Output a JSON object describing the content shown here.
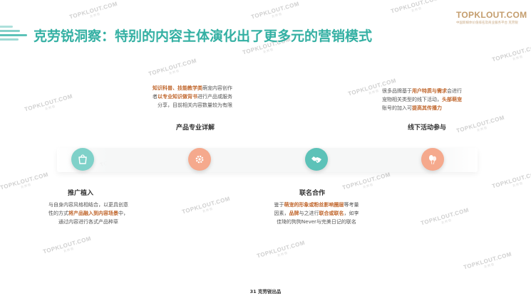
{
  "title": "克劳锐洞察：特别的内容主体演化出了更多元的营销模式",
  "logo": {
    "name": "TOPKLOUT.COM",
    "tagline": "中国新媒体价值排名及商业服务平台 克劳锐"
  },
  "watermark": {
    "text": "TOPKLOUT.COM",
    "sub": "克 劳 锐"
  },
  "stages": [
    {
      "label": "推广植入",
      "icon": "shopping-bag-icon",
      "color": "#7fd1c9",
      "lines": [
        [
          "与自身内容风格相结合，以更具创意"
        ],
        [
          "性的方式",
          {
            "h": "将产品融入到内容场景"
          },
          "中，"
        ],
        [
          "通过内容进行各式产品种草"
        ]
      ]
    },
    {
      "label": "产品专业详解",
      "icon": "gear-icon",
      "color": "#f5a98d",
      "lines": [
        [
          {
            "h": "知识科普、技能教学类"
          },
          "萌宠内容创作"
        ],
        [
          "者",
          {
            "h": "以专业知识做背书"
          },
          "进行产品或服务"
        ],
        [
          "分享，目前相关内容数量较为有限"
        ]
      ]
    },
    {
      "label": "联名合作",
      "icon": "handshake-icon",
      "color": "#5cc2b8",
      "lines": [
        [
          "鉴于",
          {
            "h": "萌宠的形象或粉丝影响圈层"
          },
          "等考量"
        ],
        [
          "因素，",
          {
            "h": "品牌"
          },
          "与之进行",
          {
            "h": "联合或联名"
          },
          "，如李"
        ],
        [
          "佳琦的狗狗Never与完美日记的联名"
        ]
      ]
    },
    {
      "label": "线下活动参与",
      "icon": "balloon-icon",
      "color": "#f5a98d",
      "lines": [
        [
          "很多品牌基于",
          {
            "h": "用户特质与需求"
          },
          "会进行"
        ],
        [
          "宠物相关类型的线下活动，",
          {
            "h": "头部萌宠"
          }
        ],
        [
          "账号的加入可",
          {
            "h": "提高其传播力"
          }
        ]
      ]
    }
  ],
  "footer": "31 克劳锐出品"
}
